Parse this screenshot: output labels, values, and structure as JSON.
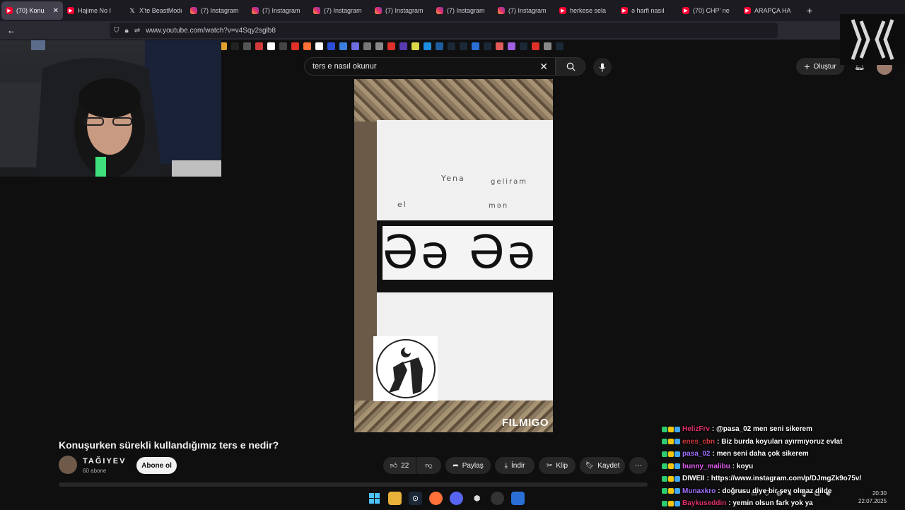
{
  "tabs": [
    {
      "title": "(70) Konu",
      "type": "yt",
      "active": true
    },
    {
      "title": "Hajime No I",
      "type": "yt"
    },
    {
      "title": "X'te BeastMode",
      "type": "x"
    },
    {
      "title": "(7) Instagram",
      "type": "ig"
    },
    {
      "title": "(7) Instagram",
      "type": "ig"
    },
    {
      "title": "(7) Instagram",
      "type": "ig"
    },
    {
      "title": "(7) Instagram",
      "type": "ig"
    },
    {
      "title": "(7) Instagram",
      "type": "ig"
    },
    {
      "title": "(7) Instagram",
      "type": "ig"
    },
    {
      "title": "herkese sela",
      "type": "yt"
    },
    {
      "title": "ə harfi nasıl",
      "type": "yt"
    },
    {
      "title": "(70) CHP' ne",
      "type": "yt"
    },
    {
      "title": "ARAPÇA HA",
      "type": "yt"
    }
  ],
  "address": {
    "url": "www.youtube.com/watch?v=v4Sqy2sglb8"
  },
  "youtube": {
    "search_query": "ters e nasıl okunur",
    "create_label": "Oluştur"
  },
  "video": {
    "handwriting_1": "Yena",
    "handwriting_2": "geliram",
    "handwriting_3": "el",
    "handwriting_4": "mən",
    "band_letters": "Əə Əə",
    "watermark": "FILMIGO",
    "title": "Konuşurken sürekli kullandığımız ters e nedir?",
    "channel_name": "TAĞIYEV",
    "channel_subs": "60 abone",
    "subscribe_label": "Abone ol",
    "like_count": "22",
    "share_label": "Paylaş",
    "download_label": "İndir",
    "clip_label": "Klip",
    "save_label": "Kaydet",
    "more_label": "⋯"
  },
  "chat": [
    {
      "user": "HelizFrv",
      "color": "#e0306a",
      "text": ": @pasa_02 men seni sikerem"
    },
    {
      "user": "enes_cbn",
      "color": "#d23b3b",
      "text": ": Biz burda koyuları ayırmıyoruz evlat"
    },
    {
      "user": "pasa_02",
      "color": "#a070ff",
      "text": ": men seni daha çok sikerem"
    },
    {
      "user": "bunny_malibu",
      "color": "#e35df0",
      "text": ": koyu"
    },
    {
      "user": "DIWEII",
      "color": "#ffffff",
      "text": ": https://www.instagram.com/p/DJmgZk9o75v/"
    },
    {
      "user": "Munaxkro",
      "color": "#a070ff",
      "text": ": doğrusu diye bir şey olmaz dilde"
    },
    {
      "user": "Baykuseddin",
      "color": "#e0306a",
      "text": ": yemin olsun fark yok ya"
    }
  ],
  "clock": {
    "time": "20:30",
    "date": "22.07.2025"
  }
}
